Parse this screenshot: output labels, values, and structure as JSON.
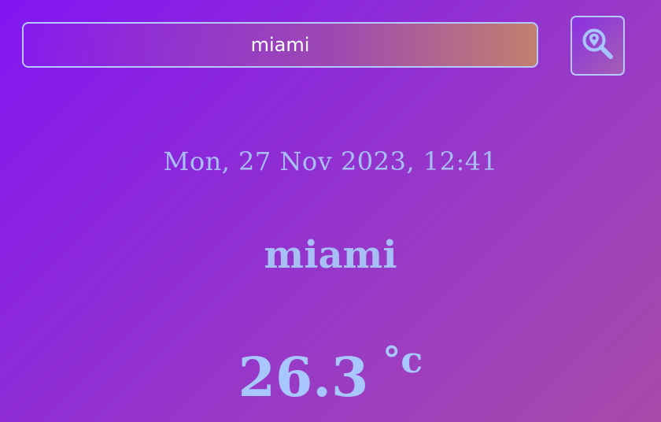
{
  "search": {
    "value": "miami",
    "icon": "search-location-icon"
  },
  "weather": {
    "datetime": "Mon, 27 Nov 2023, 12:41",
    "city": "miami",
    "temperature": "26.3",
    "unit": "°c"
  },
  "colors": {
    "text": "#a8bff5",
    "border": "#b7c7ff",
    "bg_start": "#8215f2",
    "bg_end": "#a84aa8"
  }
}
